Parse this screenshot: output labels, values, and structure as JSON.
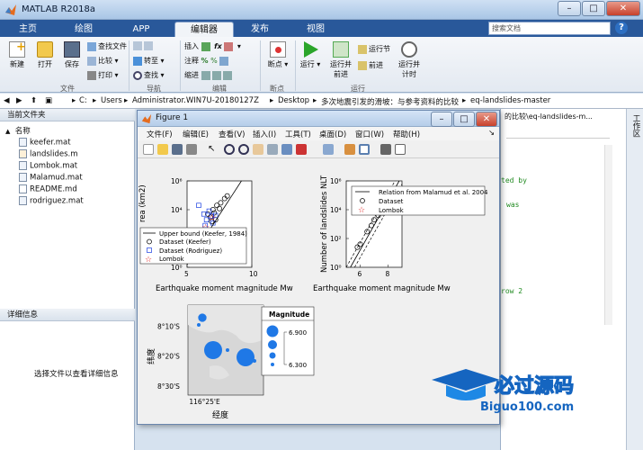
{
  "app": {
    "title": "MATLAB R2018a"
  },
  "window_buttons": [
    "–",
    "□",
    "✕"
  ],
  "tabs": [
    "主页",
    "绘图",
    "APP",
    "编辑器",
    "发布",
    "视图"
  ],
  "search": {
    "placeholder": "搜索文档"
  },
  "ribbon": {
    "new": "新建",
    "open": "打开",
    "save": "保存",
    "find_files": "查找文件",
    "compare": "比较",
    "print": "打印",
    "goto": "转至",
    "find": "查找",
    "insert": "插入",
    "comment": "注释",
    "indent": "缩进",
    "breakpoints": "断点",
    "run": "运行",
    "run_advance_1": "运行并",
    "run_advance_2": "前进",
    "run_section": "运行节",
    "advance": "前进",
    "run_time_1": "运行并",
    "run_time_2": "计时",
    "groups": {
      "file": "文件",
      "navigate": "导航",
      "edit": "编辑",
      "breakpoints": "断点",
      "run": "运行"
    }
  },
  "address": {
    "drive": "C:",
    "segments": [
      "Users",
      "Administrator.WIN7U-20180127Z",
      "Desktop",
      "多次地震引发的滑坡：与参考资料的比较",
      "eq-landslides-master"
    ],
    "sep": "▸"
  },
  "current_folder": {
    "title": "当前文件夹",
    "column": "名称",
    "sort_arrow": "▲",
    "files": [
      "keefer.mat",
      "landslides.m",
      "Lombok.mat",
      "Malamud.mat",
      "README.md",
      "rodriguez.mat"
    ]
  },
  "details": {
    "title": "详细信息",
    "hint": "选择文件以查看详细信息"
  },
  "editor": {
    "path_fragment": "的比较\\eq-landslides-m...",
    "code_lines": [
      "ted by",
      "was",
      "row 2"
    ],
    "side_tab": "工作区"
  },
  "figure": {
    "title": "Figure 1",
    "menu": [
      "文件(F)",
      "编辑(E)",
      "查看(V)",
      "插入(I)",
      "工具(T)",
      "桌面(D)",
      "窗口(W)",
      "帮助(H)"
    ],
    "menu_right": "↘"
  },
  "colors": {
    "accent": "#29589a",
    "red": "#e02020",
    "blue": "#1a3ee0",
    "bubble": "#1f78e6"
  },
  "chart_data": [
    {
      "type": "scatter",
      "xlabel": "Earthquake moment magnitude Mw",
      "ylabel_fragment": "rea (km2)",
      "xlim": [
        5,
        10
      ],
      "ylim": [
        1,
        1000000
      ],
      "y_scale": "log",
      "xticks": [
        "5",
        "10"
      ],
      "yticks": [
        "10⁰",
        "10²",
        "10⁴",
        "10⁶"
      ],
      "legend": [
        "Upper bound (Keefer, 1984)",
        "Dataset (Keefer)",
        "Dataset (Rodriguez)",
        "Lombok"
      ],
      "legend_placement": "lower-left",
      "series": [
        {
          "name": "Dataset (Keefer)",
          "marker": "circle",
          "color": "#000000",
          "points": [
            [
              6.6,
              5000
            ],
            [
              6.8,
              3000
            ],
            [
              7.0,
              10000
            ],
            [
              7.1,
              6000
            ],
            [
              7.3,
              20000
            ],
            [
              7.5,
              12000
            ],
            [
              7.6,
              30000
            ],
            [
              7.9,
              60000
            ],
            [
              8.1,
              90000
            ],
            [
              7.2,
              2000
            ],
            [
              6.9,
              1500
            ]
          ]
        },
        {
          "name": "Dataset (Rodriguez)",
          "marker": "square",
          "color": "#1a3ee0",
          "points": [
            [
              5.9,
              20000
            ],
            [
              6.3,
              5000
            ],
            [
              6.5,
              2000
            ],
            [
              6.7,
              8000
            ],
            [
              6.9,
              3500
            ],
            [
              7.0,
              1200
            ],
            [
              6.4,
              800
            ],
            [
              7.2,
              4000
            ]
          ]
        },
        {
          "name": "Lombok",
          "marker": "star",
          "color": "#e02020",
          "points": [
            [
              6.9,
              3000
            ],
            [
              6.4,
              600
            ]
          ]
        },
        {
          "name": "Upper bound (Keefer, 1984)",
          "marker": "line",
          "color": "#000000",
          "points": [
            [
              5.0,
              1.5
            ],
            [
              9.2,
              1000000
            ]
          ]
        }
      ]
    },
    {
      "type": "scatter",
      "ylabel": "Number of landslides NLT",
      "xlabel": "Earthquake moment magnitude Mw",
      "xlim": [
        5,
        9
      ],
      "ylim": [
        1,
        1000000
      ],
      "y_scale": "log",
      "xticks": [
        "6",
        "8"
      ],
      "yticks": [
        "10⁰",
        "10²",
        "10⁴",
        "10⁶"
      ],
      "legend": [
        "Relation from Malamud et al. 2004",
        "Dataset",
        "Lombok"
      ],
      "legend_placement": "top-right",
      "series": [
        {
          "name": "Dataset",
          "marker": "circle",
          "color": "#000000",
          "points": [
            [
              5.8,
              25
            ],
            [
              6.0,
              40
            ],
            [
              6.5,
              300
            ],
            [
              6.8,
              800
            ],
            [
              7.0,
              2000
            ],
            [
              7.3,
              4000
            ],
            [
              7.6,
              6000
            ],
            [
              7.8,
              10000
            ]
          ]
        },
        {
          "name": "Lombok",
          "marker": "star",
          "color": "#e02020",
          "points": [
            [
              6.4,
              30000
            ]
          ]
        }
      ]
    },
    {
      "type": "scatter",
      "subtype": "bubble-map",
      "xlabel": "经度",
      "ylabel": "纬度",
      "xticks": [
        "116°25'E"
      ],
      "yticks": [
        "8°10'S",
        "8°20'S",
        "8°30'S"
      ],
      "legend_title": "Magnitude",
      "legend_values": [
        "6.900",
        "6.300"
      ],
      "series": [
        {
          "name": "Magnitude",
          "color": "#1f78e6",
          "points": [
            [
              116.46,
              -8.12,
              6.5
            ],
            [
              116.44,
              -8.16,
              6.3
            ],
            [
              116.52,
              -8.3,
              6.9
            ],
            [
              116.6,
              -8.3,
              6.3
            ],
            [
              116.7,
              -8.34,
              6.9
            ],
            [
              116.75,
              -8.36,
              6.3
            ]
          ]
        }
      ]
    }
  ],
  "watermark": {
    "text": "必过源码",
    "url": "Biguo100.com"
  }
}
